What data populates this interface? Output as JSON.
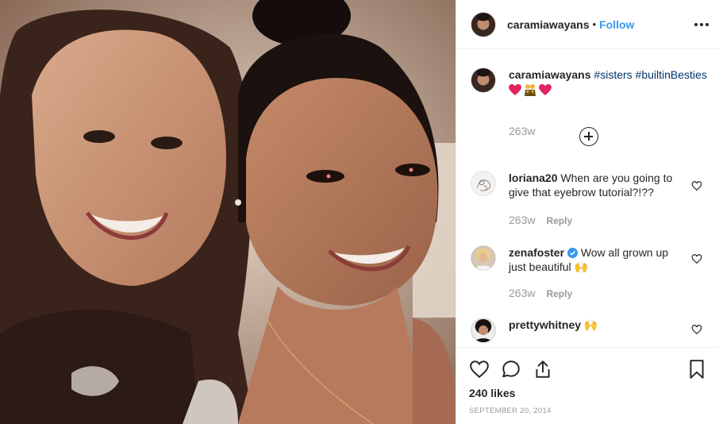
{
  "post": {
    "photo_alt": "",
    "header": {
      "username": "caramiawayans",
      "separator": "•",
      "follow_label": "Follow",
      "more_icon": "more-horizontal-icon"
    },
    "caption": {
      "username": "caramiawayans",
      "hashtags": [
        "#sisters",
        "#builtinBesties"
      ],
      "emojis": [
        "heart-emoji",
        "people-emoji",
        "heart-emoji"
      ],
      "time": "263w"
    },
    "load_more_icon": "plus-circle-icon",
    "comments": [
      {
        "username": "loriana20",
        "text": "When are you going to give that eyebrow tutorial?!??",
        "time": "263w",
        "reply_label": "Reply"
      },
      {
        "username": "zenafoster",
        "verified": true,
        "text": "Wow all grown up just beautiful 🙌",
        "time": "263w",
        "reply_label": "Reply"
      },
      {
        "username": "prettywhitney",
        "text": "🙌"
      }
    ],
    "actions": {
      "like_icon": "heart-outline-icon",
      "comment_icon": "comment-icon",
      "share_icon": "share-icon",
      "save_icon": "bookmark-icon"
    },
    "likes": "240 likes",
    "date": "SEPTEMBER 20, 2014",
    "colors": {
      "link": "#3897f0",
      "hashtag": "#003569",
      "muted": "#999999",
      "text": "#262626",
      "heart_emoji": "#e0245e"
    }
  }
}
